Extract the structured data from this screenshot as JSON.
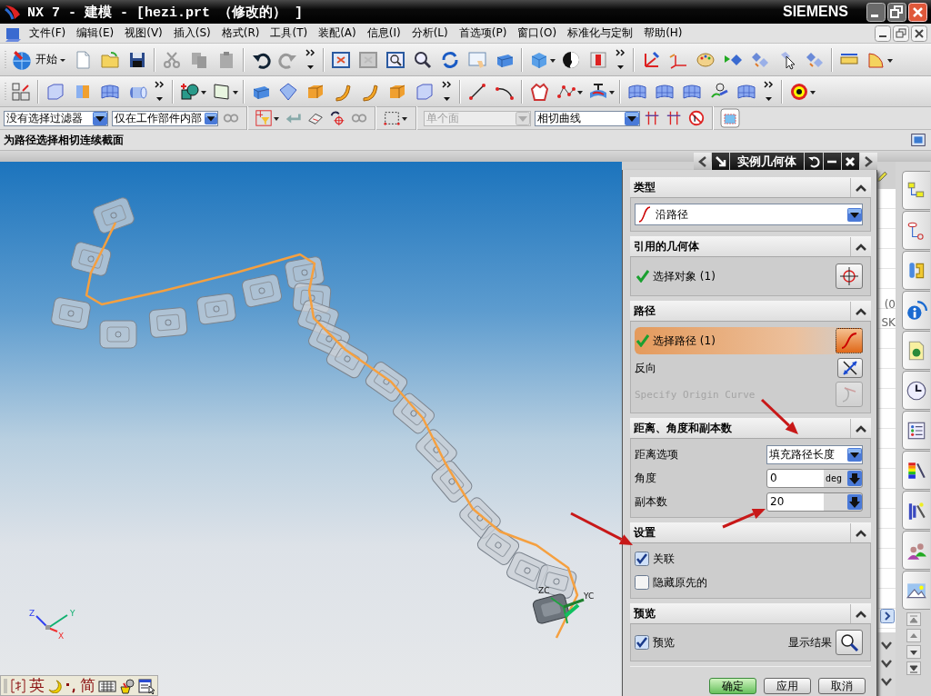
{
  "window": {
    "title": "NX 7 - 建模 - [hezi.prt （修改的） ]",
    "brand": "SIEMENS"
  },
  "menu": [
    "文件(F)",
    "编辑(E)",
    "视图(V)",
    "插入(S)",
    "格式(R)",
    "工具(T)",
    "装配(A)",
    "信息(I)",
    "分析(L)",
    "首选项(P)",
    "窗口(O)",
    "标准化与定制",
    "帮助(H)"
  ],
  "toolbar": {
    "start_label": "开始"
  },
  "selection_bar": {
    "filter": {
      "value": "没有选择过滤器",
      "disabled": false
    },
    "scope": {
      "value": "仅在工作部件内部",
      "disabled": false
    },
    "face_rule": {
      "value": "单个面",
      "disabled": true
    },
    "curve_rule": {
      "value": "相切曲线",
      "disabled": false
    }
  },
  "prompt": "为路径选择相切连续截面",
  "viewport": {
    "triad_labels": [
      "Z",
      "Y",
      "X"
    ],
    "wcs_labels": [
      "ZC",
      "YC"
    ]
  },
  "navigator": {
    "fragments": [
      "(0",
      "SK"
    ]
  },
  "ime_bar": {
    "language": "英",
    "charset": "简"
  },
  "dialog": {
    "title": "实例几何体",
    "sections": [
      {
        "title": "类型",
        "expanded": true,
        "rows": [
          {
            "kind": "type-dropdown",
            "value": "沿路径"
          }
        ]
      },
      {
        "title": "引用的几何体",
        "expanded": true,
        "rows": [
          {
            "kind": "object-selection",
            "label": "选择对象 (1)",
            "selected": false,
            "complete": true
          }
        ]
      },
      {
        "title": "路径",
        "expanded": true,
        "rows": [
          {
            "kind": "curve-selection",
            "label": "选择路径 (1)",
            "selected": true,
            "complete": true
          },
          {
            "kind": "reverse-action",
            "label": "反向",
            "disabled": false
          },
          {
            "kind": "origin-curve-action",
            "label": "Specify Origin Curve",
            "disabled": true
          }
        ]
      },
      {
        "title": "距离、角度和副本数",
        "expanded": true,
        "rows": [
          {
            "kind": "dropdown-field",
            "label": "距离选项",
            "value": "填充路径长度"
          },
          {
            "kind": "number-field",
            "label": "角度",
            "value": "0",
            "unit": "deg"
          },
          {
            "kind": "number-field",
            "label": "副本数",
            "value": "20"
          }
        ]
      },
      {
        "title": "设置",
        "expanded": true,
        "rows": [
          {
            "kind": "checkbox",
            "label": "关联",
            "checked": true
          },
          {
            "kind": "checkbox",
            "label": "隐藏原先的",
            "checked": false
          }
        ]
      },
      {
        "title": "预览",
        "expanded": true,
        "rows": [
          {
            "kind": "preview",
            "label": "预览",
            "checked": true,
            "button_label": "显示结果"
          }
        ]
      }
    ],
    "buttons": [
      {
        "label": "确定",
        "default": true
      },
      {
        "label": "应用",
        "default": false
      },
      {
        "label": "取消",
        "default": false
      }
    ]
  }
}
